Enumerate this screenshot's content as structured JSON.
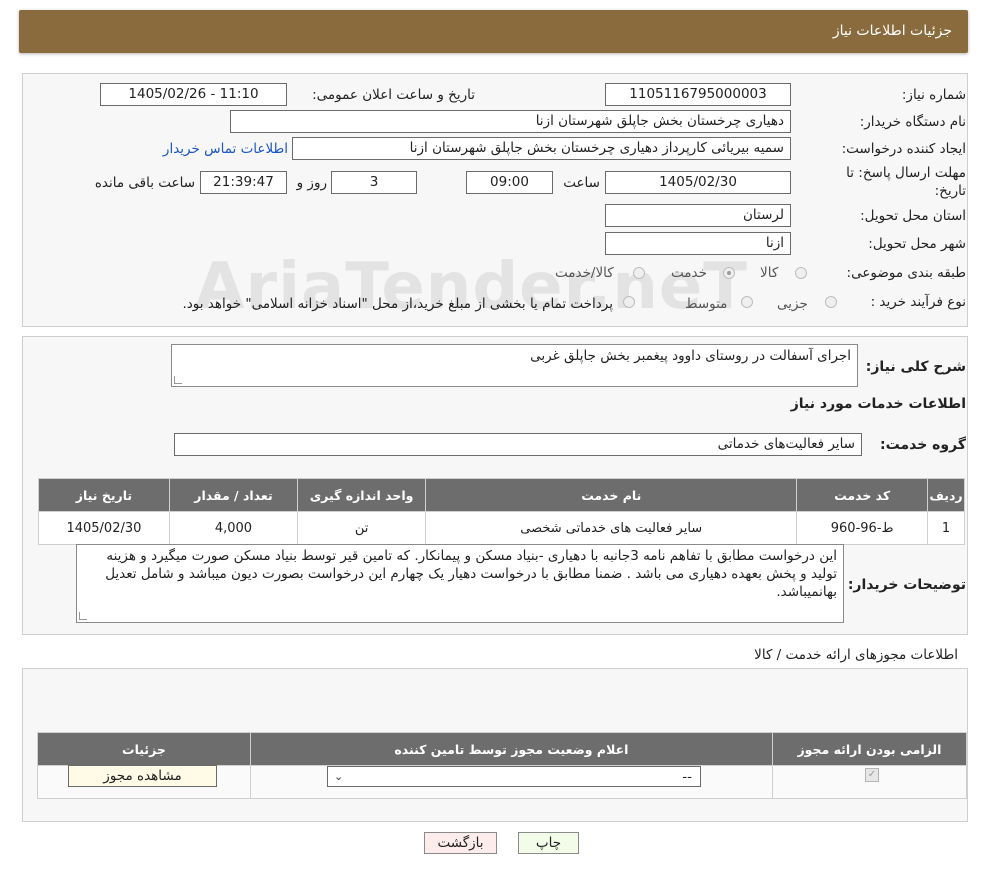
{
  "header": {
    "title": "جزئیات اطلاعات نیاز"
  },
  "form": {
    "need_number_label": "شماره نیاز:",
    "need_number": "1105116795000003",
    "announce_label": "تاریخ و ساعت اعلان عمومی:",
    "announce_value": "1405/02/26 - 11:10",
    "buyer_org_label": "نام دستگاه خریدار:",
    "buyer_org": "دهیاری چرخستان بخش جاپلق شهرستان ازنا",
    "requester_label": "ایجاد کننده درخواست:",
    "requester": "سمیه بیریائی کارپرداز دهیاری چرخستان بخش جاپلق شهرستان ازنا",
    "contact_link": "اطلاعات تماس خریدار",
    "deadline_label_line1": "مهلت ارسال پاسخ: تا",
    "deadline_label_line2": "تاریخ:",
    "deadline_date": "1405/02/30",
    "time_label": "ساعت",
    "deadline_time": "09:00",
    "days_value": "3",
    "days_label": "روز و",
    "remaining_time": "21:39:47",
    "remaining_label": "ساعت باقی مانده",
    "province_label": "استان محل تحویل:",
    "province": "لرستان",
    "city_label": "شهر محل تحویل:",
    "city": "ازنا",
    "category_label": "طبقه بندی موضوعی:",
    "category_options": [
      "کالا",
      "خدمت",
      "کالا/خدمت"
    ],
    "category_selected": "خدمت",
    "process_label": "نوع فرآیند خرید :",
    "process_options": [
      "جزیی",
      "متوسط"
    ],
    "process_note": "پرداخت تمام یا بخشی از مبلغ خرید،از محل \"اسناد خزانه اسلامی\" خواهد بود."
  },
  "watermark": "AriaTender.neT",
  "description": {
    "label": "شرح کلی نیاز:",
    "value": "اجرای آسفالت در روستای داوود پیغمبر بخش جاپلق غربی"
  },
  "services": {
    "section_title": "اطلاعات خدمات مورد نیاز",
    "group_label": "گروه خدمت:",
    "group_value": "سایر فعالیت‌های خدماتی",
    "columns": [
      "ردیف",
      "کد خدمت",
      "نام خدمت",
      "واحد اندازه گیری",
      "تعداد / مقدار",
      "تاریخ نیاز"
    ],
    "rows": [
      {
        "row": "1",
        "code": "ط-96-960",
        "name": "سایر فعالیت های خدماتی شخصی",
        "unit": "تن",
        "qty": "4,000",
        "date": "1405/02/30"
      }
    ]
  },
  "buyer_notes": {
    "label": "توضیحات خریدار:",
    "value": "این درخواست مطابق با تفاهم نامه 3جانبه با دهیاری -بنیاد مسکن و پیمانکار. که تامین قیر توسط بنیاد مسکن صورت میگیرد و هزینه تولید و پخش بعهده دهیاری می باشد . ضمنا مطابق با درخواست دهیار یک چهارم این درخواست بصورت دیون میباشد و شامل تعدیل بهانمیباشد."
  },
  "permits": {
    "section_title": "اطلاعات مجوزهای ارائه خدمت / کالا",
    "columns": [
      "الزامی بودن ارائه مجوز",
      "اعلام وضعیت مجوز توسط تامین کننده",
      "جزئیات"
    ],
    "select_value": "--",
    "view_button": "مشاهده مجوز"
  },
  "buttons": {
    "print": "چاپ",
    "back": "بازگشت"
  }
}
